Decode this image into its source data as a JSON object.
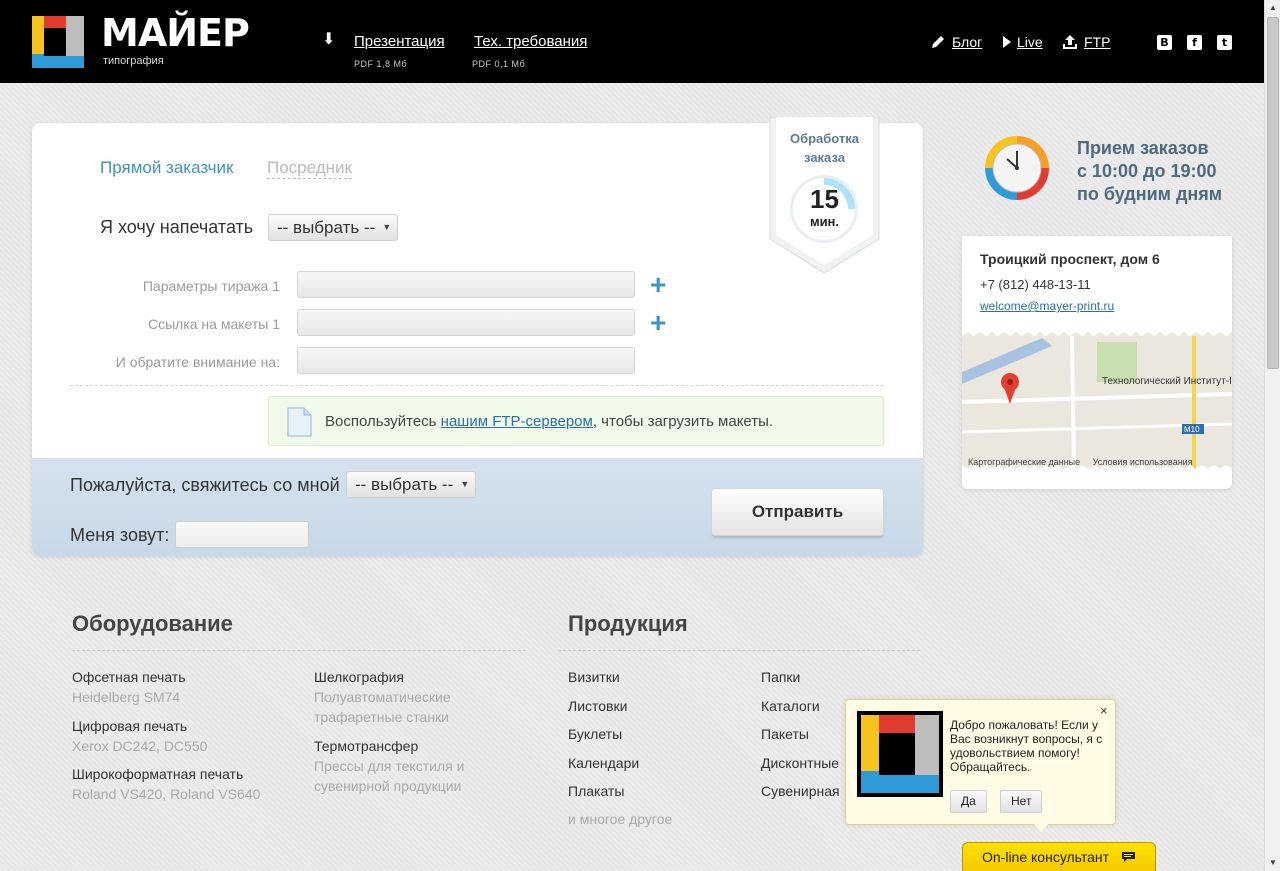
{
  "header": {
    "brand_title": "МАЙЕР",
    "brand_subtitle": "типография",
    "links": [
      {
        "label": "Презентация",
        "meta": "PDF 1,8 Мб"
      },
      {
        "label": "Тех. требования",
        "meta": "PDF 0,1 Мб"
      }
    ],
    "right_links": [
      "Блог",
      "Live",
      "FTP"
    ],
    "social": [
      "B",
      "f",
      "t"
    ]
  },
  "form": {
    "tab_direct": "Прямой заказчик",
    "tab_agent": "Посредник",
    "want_label": "Я хочу напечатать",
    "select_placeholder": "-- выбрать --",
    "fields": [
      {
        "label": "Параметры тиража 1",
        "value": ""
      },
      {
        "label": "Ссылка на макеты 1",
        "value": ""
      },
      {
        "label": "И обратите внимание на:",
        "value": ""
      }
    ],
    "ftp_note_before": "Воспользуйтесь ",
    "ftp_note_link": "нашим FTP-сервером",
    "ftp_note_after": ", чтобы загрузить макеты.",
    "contact_label": "Пожалуйста, свяжитесь со мной",
    "contact_select": "-- выбрать --",
    "name_label": "Меня зовут:",
    "name_value": "",
    "submit": "Отправить"
  },
  "badge": {
    "title_line1": "Обработка",
    "title_line2": "заказа",
    "minutes": "15",
    "unit": "мин."
  },
  "hours": {
    "line1": "Прием заказов",
    "line2": "с 10:00 до 19:00",
    "line3": "по будним дням"
  },
  "address": {
    "street": "Троицкий проспект, дом 6",
    "phone": "+7 (812) 448-13-11",
    "email": "welcome@mayer-print.ru",
    "map_label": "Технологический Институт-II",
    "map_badge": "M10",
    "map_data": "Картографические данные",
    "map_terms": "Условия использования"
  },
  "equipment": {
    "title": "Оборудование",
    "col1": [
      {
        "name": "Офсетная печать",
        "detail": "Heidelberg SM74"
      },
      {
        "name": "Цифровая печать",
        "detail": "Xerox DC242, DC550"
      },
      {
        "name": "Широкоформатная печать",
        "detail": "Roland VS420, Roland VS640"
      }
    ],
    "col2": [
      {
        "name": "Шелкография",
        "detail_line1": "Полуавтоматические",
        "detail_line2": "трафаретные станки"
      },
      {
        "name": "Термотрансфер",
        "detail_line1": "Прессы для текстиля и",
        "detail_line2": "сувенирной продукции"
      }
    ]
  },
  "products": {
    "title": "Продукция",
    "col1": [
      "Визитки",
      "Листовки",
      "Буклеты",
      "Календари",
      "Плакаты"
    ],
    "more": "и многое другое",
    "col2": [
      "Папки",
      "Каталоги",
      "Пакеты",
      "Дисконтные",
      "Сувенирная"
    ]
  },
  "chat": {
    "message": "Добро пожаловать! Если у Вас возникнут вопросы, я с удовольствием помогу! Обращайтесь.",
    "yes": "Да",
    "no": "Нет",
    "close": "×",
    "bar_label": "On-line консультант"
  },
  "colors": {
    "accent_blue": "#3b94c5",
    "consult_yellow": "#ffe100",
    "header_bg": "#000000"
  }
}
